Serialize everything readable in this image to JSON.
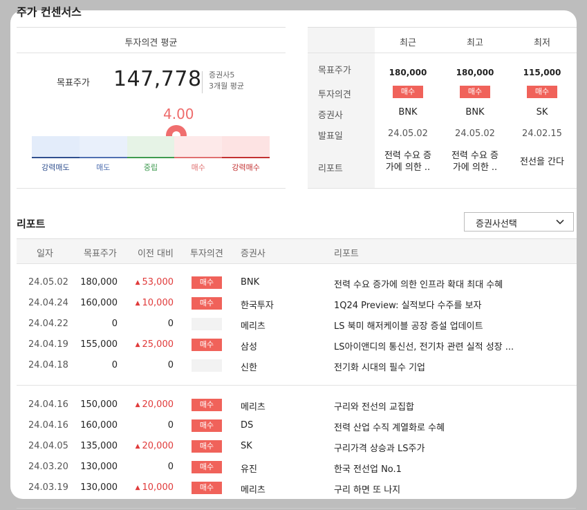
{
  "section_title": "주가 컨센서스",
  "opinion_avg": {
    "header": "투자의견 평균",
    "target_label": "목표주가",
    "target_value": "147,778",
    "broker_count": "증권사5",
    "period": "3개월 평균",
    "score": "4.00",
    "gauge_labels": [
      "강력매도",
      "매도",
      "중립",
      "매수",
      "강력매수"
    ]
  },
  "broker_summary": {
    "columns": [
      "최근",
      "최고",
      "최저"
    ],
    "row_labels": [
      "목표주가",
      "투자의견",
      "증권사",
      "발표일",
      "리포트"
    ],
    "recent": {
      "price": "180,000",
      "opinion": "매수",
      "broker": "BNK",
      "date": "24.05.02",
      "report": [
        "전력 수요 증",
        "가에 의한 .."
      ]
    },
    "high": {
      "price": "180,000",
      "opinion": "매수",
      "broker": "BNK",
      "date": "24.05.02",
      "report": [
        "전력 수요 증",
        "가에 의한 .."
      ]
    },
    "low": {
      "price": "115,000",
      "opinion": "매수",
      "broker": "SK",
      "date": "24.02.15",
      "report": [
        "전선을 간다",
        ""
      ]
    }
  },
  "reports": {
    "title": "리포트",
    "select_label": "증권사선택",
    "headers": [
      "일자",
      "목표주가",
      "이전 대비",
      "투자의견",
      "증권사",
      "리포트"
    ],
    "rows": [
      {
        "date": "24.05.02",
        "target": "180,000",
        "diff": "53,000",
        "opinion": "매수",
        "broker": "BNK",
        "report": "전력 수요 증가에 의한 인프라 확대 최대 수혜"
      },
      {
        "date": "24.04.24",
        "target": "160,000",
        "diff": "10,000",
        "opinion": "매수",
        "broker": "한국투자",
        "report": "1Q24 Preview: 실적보다 수주를 보자"
      },
      {
        "date": "24.04.22",
        "target": "0",
        "diff": "0",
        "opinion": "",
        "broker": "메리츠",
        "report": "LS 북미 해저케이블 공장 증설 업데이트"
      },
      {
        "date": "24.04.19",
        "target": "155,000",
        "diff": "25,000",
        "opinion": "매수",
        "broker": "삼성",
        "report": "LS아이앤디의 통신선, 전기차 관련 실적 성장 ..."
      },
      {
        "date": "24.04.18",
        "target": "0",
        "diff": "0",
        "opinion": "",
        "broker": "신한",
        "report": "전기화 시대의 필수 기업"
      },
      {
        "date": "24.04.16",
        "target": "150,000",
        "diff": "20,000",
        "opinion": "매수",
        "broker": "메리츠",
        "report": "구리와 전선의 교집합"
      },
      {
        "date": "24.04.16",
        "target": "160,000",
        "diff": "0",
        "opinion": "매수",
        "broker": "DS",
        "report": "전력 산업 수직 계열화로 수혜"
      },
      {
        "date": "24.04.05",
        "target": "135,000",
        "diff": "20,000",
        "opinion": "매수",
        "broker": "SK",
        "report": "구리가격 상승과 LS주가"
      },
      {
        "date": "24.03.20",
        "target": "130,000",
        "diff": "0",
        "opinion": "매수",
        "broker": "유진",
        "report": "한국 전선업 No.1"
      },
      {
        "date": "24.03.19",
        "target": "130,000",
        "diff": "10,000",
        "opinion": "매수",
        "broker": "메리츠",
        "report": "구리 하면 또 나지"
      }
    ]
  },
  "colors": {
    "buy_badge": "#f0625a",
    "up": "#e03a3a",
    "score": "#ee6b6b"
  },
  "icons": {
    "pin": "location-pin-icon",
    "select": "chevron-down-icon",
    "up": "triangle-up-icon"
  }
}
